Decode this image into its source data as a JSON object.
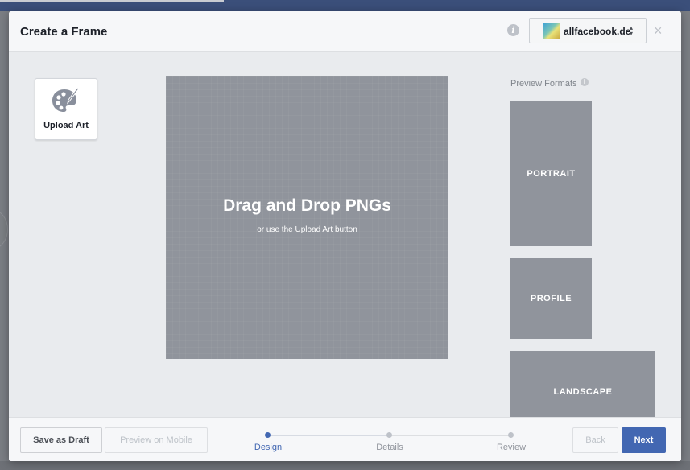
{
  "modal": {
    "title": "Create a Frame",
    "page_selector": {
      "name": "allfacebook.de",
      "caret": "▴\n▾"
    },
    "close_glyph": "×",
    "info_glyph": "i"
  },
  "upload_art": {
    "label": "Upload Art",
    "icon": "palette-icon"
  },
  "canvas": {
    "title": "Drag and Drop PNGs",
    "subtitle": "or use the Upload Art button"
  },
  "preview": {
    "label": "Preview Formats",
    "formats": [
      "PORTRAIT",
      "PROFILE",
      "LANDSCAPE"
    ]
  },
  "footer": {
    "save_draft": "Save as Draft",
    "preview_mobile": "Preview on Mobile",
    "back": "Back",
    "next": "Next",
    "steps": [
      {
        "label": "Design",
        "active": true
      },
      {
        "label": "Details",
        "active": false
      },
      {
        "label": "Review",
        "active": false
      }
    ]
  },
  "colors": {
    "accent": "#4267b2",
    "canvas_gray": "#90949c",
    "modal_bg": "#e9ebee"
  }
}
